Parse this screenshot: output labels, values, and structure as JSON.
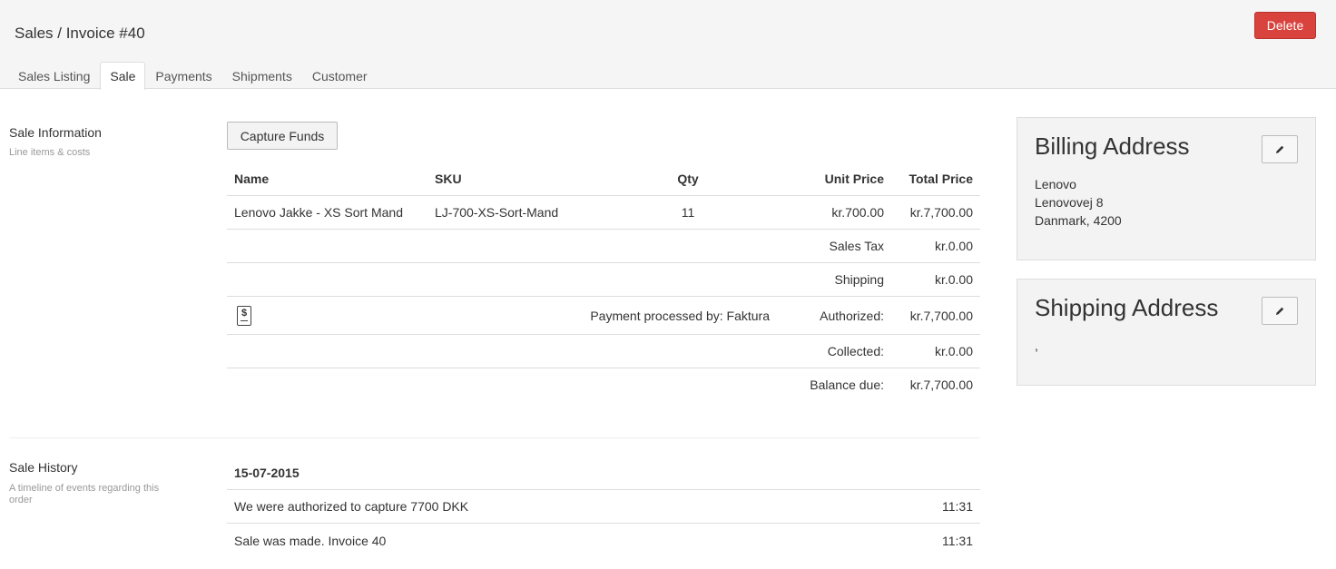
{
  "header": {
    "title": "Sales / Invoice #40",
    "delete_label": "Delete"
  },
  "tabs": [
    {
      "label": "Sales Listing",
      "active": false
    },
    {
      "label": "Sale",
      "active": true
    },
    {
      "label": "Payments",
      "active": false
    },
    {
      "label": "Shipments",
      "active": false
    },
    {
      "label": "Customer",
      "active": false
    }
  ],
  "sale_info": {
    "title": "Sale Information",
    "subtitle": "Line items & costs",
    "capture_label": "Capture Funds",
    "columns": {
      "name": "Name",
      "sku": "SKU",
      "qty": "Qty",
      "unit_price": "Unit Price",
      "total_price": "Total Price"
    },
    "line_items": [
      {
        "name": "Lenovo Jakke - XS Sort Mand",
        "sku": "LJ-700-XS-Sort-Mand",
        "qty": "11",
        "unit_price": "kr.700.00",
        "total_price": "kr.7,700.00"
      }
    ],
    "totals": {
      "sales_tax_label": "Sales Tax",
      "sales_tax": "kr.0.00",
      "shipping_label": "Shipping",
      "shipping": "kr.0.00",
      "payment_processed": "Payment processed by: Faktura",
      "authorized_label": "Authorized:",
      "authorized": "kr.7,700.00",
      "collected_label": "Collected:",
      "collected": "kr.0.00",
      "balance_label": "Balance due:",
      "balance": "kr.7,700.00"
    },
    "payment_icon_glyph": "$"
  },
  "sale_history": {
    "title": "Sale History",
    "subtitle": "A timeline of events regarding this order",
    "date": "15-07-2015",
    "events": [
      {
        "text": "We were authorized to capture 7700 DKK",
        "time": "11:31"
      },
      {
        "text": "Sale was made. Invoice 40",
        "time": "11:31"
      }
    ]
  },
  "billing": {
    "title": "Billing Address",
    "lines": [
      "Lenovo",
      "Lenovovej 8",
      "Danmark, 4200"
    ]
  },
  "shipping": {
    "title": "Shipping Address",
    "lines": [
      ","
    ]
  },
  "colors": {
    "delete": "#d9433d",
    "panel_bg": "#f3f3f3",
    "topbar_bg": "#f5f5f5"
  }
}
